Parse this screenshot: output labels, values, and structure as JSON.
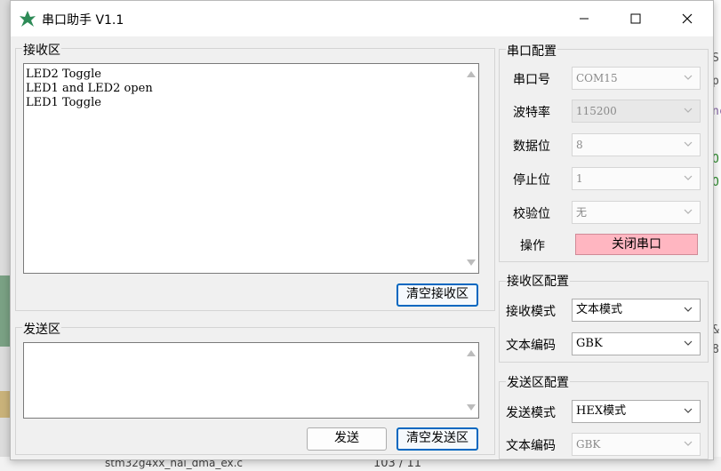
{
  "window": {
    "title": "串口助手 V1.1"
  },
  "receive": {
    "group_title": "接收区",
    "lines": [
      "LED2 Toggle",
      "LED1 and LED2 open",
      "LED1 Toggle"
    ],
    "clear_button": "清空接收区"
  },
  "send": {
    "group_title": "发送区",
    "content": "",
    "send_button": "发送",
    "clear_button": "清空发送区"
  },
  "serial_config": {
    "group_title": "串口配置",
    "fields": [
      {
        "label": "串口号",
        "value": "COM15"
      },
      {
        "label": "波特率",
        "value": "115200"
      },
      {
        "label": "数据位",
        "value": "8"
      },
      {
        "label": "停止位",
        "value": "1"
      },
      {
        "label": "校验位",
        "value": "无"
      }
    ],
    "operation_label": "操作",
    "operation_button": "关闭串口",
    "operation_button_color": "#ffb6c1"
  },
  "receive_config": {
    "group_title": "接收区配置",
    "mode_label": "接收模式",
    "mode_value": "文本模式",
    "encoding_label": "文本编码",
    "encoding_value": "GBK"
  },
  "send_config": {
    "group_title": "发送区配置",
    "mode_label": "发送模式",
    "mode_value": "HEX模式",
    "encoding_label": "文本编码",
    "encoding_value": "GBK"
  },
  "background": {
    "file_name": "stm32g4xx_hal_dma_ex.c",
    "right_glyphs": [
      "S",
      "p",
      "nc",
      "O",
      "O",
      "&",
      "8"
    ],
    "bottom_number": "103 / 11"
  },
  "colors": {
    "accent": "#0067c0",
    "close_port": "#ffb6c1",
    "window_bg": "#f0f0f0"
  },
  "icons": [
    "app-icon",
    "minimize-icon",
    "maximize-icon",
    "close-icon",
    "scroll-up-icon",
    "scroll-down-icon",
    "chevron-down-icon"
  ]
}
